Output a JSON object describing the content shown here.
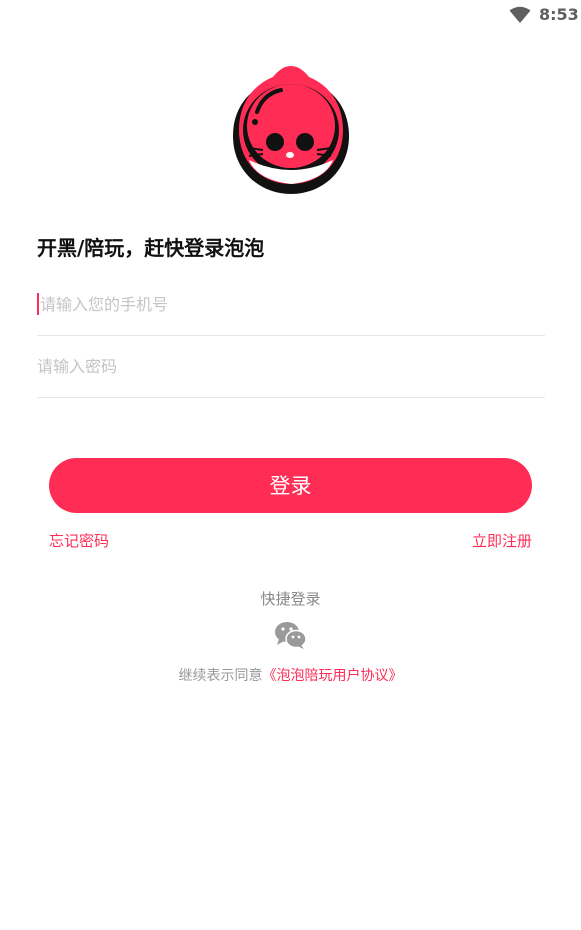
{
  "status_bar": {
    "time": "8:53",
    "wifi_icon": "wifi-icon"
  },
  "logo": {
    "icon": "bubble-cat-logo",
    "brand_color": "#ff2d55"
  },
  "headline": "开黑/陪玩，赶快登录泡泡",
  "form": {
    "phone_placeholder": "请输入您的手机号",
    "phone_value": "",
    "password_placeholder": "请输入密码",
    "password_value": ""
  },
  "login_button_label": "登录",
  "links": {
    "forgot_password": "忘记密码",
    "register": "立即注册"
  },
  "quick_login": {
    "title": "快捷登录",
    "icon": "wechat-icon"
  },
  "agreement": {
    "prefix": "继续表示同意",
    "link_text": "《泡泡陪玩用户协议》"
  },
  "colors": {
    "accent": "#ff2d55",
    "text_dark": "#111111",
    "placeholder": "#c4c4c4",
    "muted": "#888888"
  }
}
